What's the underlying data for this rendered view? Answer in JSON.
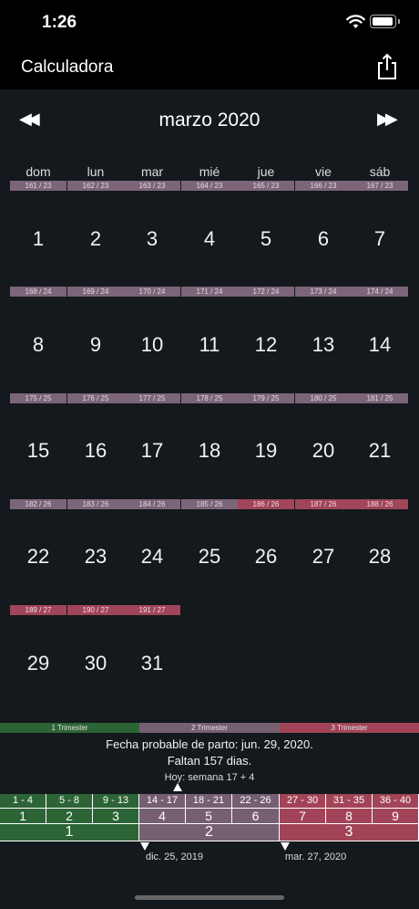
{
  "status_bar": {
    "time": "1:26"
  },
  "nav": {
    "title": "Calculadora"
  },
  "calendar": {
    "month_title": "marzo 2020",
    "prev_icon": "double-left-arrow",
    "next_icon": "double-right-arrow",
    "weekdays": [
      "dom",
      "lun",
      "mar",
      "mié",
      "jue",
      "vie",
      "sáb"
    ],
    "weeks": [
      [
        {
          "day": "1",
          "tag": "161 / 23",
          "tri": 2
        },
        {
          "day": "2",
          "tag": "162 / 23",
          "tri": 2
        },
        {
          "day": "3",
          "tag": "163 / 23",
          "tri": 2
        },
        {
          "day": "4",
          "tag": "164 / 23",
          "tri": 2
        },
        {
          "day": "5",
          "tag": "165 / 23",
          "tri": 2
        },
        {
          "day": "6",
          "tag": "166 / 23",
          "tri": 2
        },
        {
          "day": "7",
          "tag": "167 / 23",
          "tri": 2
        }
      ],
      [
        {
          "day": "8",
          "tag": "168 / 24",
          "tri": 2
        },
        {
          "day": "9",
          "tag": "169 / 24",
          "tri": 2
        },
        {
          "day": "10",
          "tag": "170 / 24",
          "tri": 2
        },
        {
          "day": "11",
          "tag": "171 / 24",
          "tri": 2
        },
        {
          "day": "12",
          "tag": "172 / 24",
          "tri": 2
        },
        {
          "day": "13",
          "tag": "173 / 24",
          "tri": 2
        },
        {
          "day": "14",
          "tag": "174 / 24",
          "tri": 2
        }
      ],
      [
        {
          "day": "15",
          "tag": "175 / 25",
          "tri": 2
        },
        {
          "day": "16",
          "tag": "176 / 25",
          "tri": 2
        },
        {
          "day": "17",
          "tag": "177 / 25",
          "tri": 2
        },
        {
          "day": "18",
          "tag": "178 / 25",
          "tri": 2
        },
        {
          "day": "19",
          "tag": "179 / 25",
          "tri": 2
        },
        {
          "day": "20",
          "tag": "180 / 25",
          "tri": 2
        },
        {
          "day": "21",
          "tag": "181 / 25",
          "tri": 2
        }
      ],
      [
        {
          "day": "22",
          "tag": "182 / 26",
          "tri": 2
        },
        {
          "day": "23",
          "tag": "183 / 26",
          "tri": 2
        },
        {
          "day": "24",
          "tag": "184 / 26",
          "tri": 2
        },
        {
          "day": "25",
          "tag": "185 / 26",
          "tri": 2
        },
        {
          "day": "26",
          "tag": "186 / 26",
          "tri": 3
        },
        {
          "day": "27",
          "tag": "187 / 26",
          "tri": 3
        },
        {
          "day": "28",
          "tag": "188 / 26",
          "tri": 3
        }
      ],
      [
        {
          "day": "29",
          "tag": "189 / 27",
          "tri": 3
        },
        {
          "day": "30",
          "tag": "190 / 27",
          "tri": 3
        },
        {
          "day": "31",
          "tag": "191 / 27",
          "tri": 3
        }
      ]
    ]
  },
  "trimester_bar": [
    "1 Trimester",
    "2 Trimester",
    "3 Trimester"
  ],
  "info": {
    "due_date": "Fecha probable de parto: jun. 29, 2020.",
    "remaining": "Faltan 157 dias.",
    "today": "Hoy: semana 17 + 4"
  },
  "pregnancy_grid": {
    "week_ranges": [
      "1 - 4",
      "5 - 8",
      "9 - 13",
      "14 - 17",
      "18 - 21",
      "22 - 26",
      "27 - 30",
      "31 - 35",
      "36 - 40"
    ],
    "months": [
      "1",
      "2",
      "3",
      "4",
      "5",
      "6",
      "7",
      "8",
      "9"
    ],
    "trimesters": [
      "1",
      "2",
      "3"
    ]
  },
  "markers": {
    "start_date": "dic. 25, 2019",
    "third_trimester_date": "mar. 27, 2020"
  },
  "colors": {
    "trimester_1": "#2d6436",
    "trimester_2": "#755f71",
    "trimester_3": "#a24457",
    "background": "#13191c"
  }
}
